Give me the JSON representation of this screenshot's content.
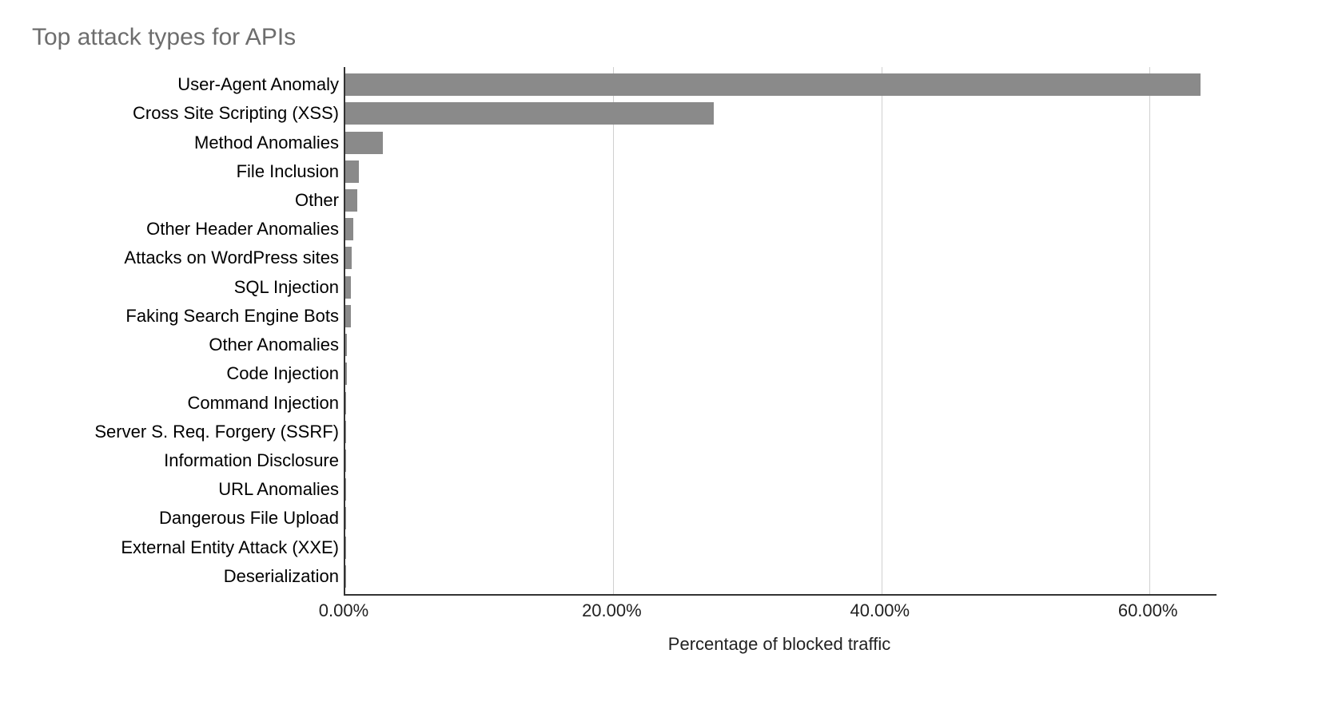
{
  "chart_data": {
    "type": "bar",
    "orientation": "horizontal",
    "title": "Top attack types for APIs",
    "xlabel": "Percentage of blocked traffic",
    "ylabel": "",
    "categories": [
      "User-Agent Anomaly",
      "Cross Site Scripting (XSS)",
      "Method Anomalies",
      "File Inclusion",
      "Other",
      "Other Header Anomalies",
      "Attacks on WordPress sites",
      "SQL Injection",
      "Faking Search Engine Bots",
      "Other Anomalies",
      "Code Injection",
      "Command Injection",
      "Server S. Req. Forgery (SSRF)",
      "Information Disclosure",
      "URL Anomalies",
      "Dangerous File Upload",
      "External Entity Attack (XXE)",
      "Deserialization"
    ],
    "values": [
      63.8,
      27.5,
      2.8,
      1.0,
      0.9,
      0.6,
      0.5,
      0.4,
      0.4,
      0.1,
      0.1,
      0.05,
      0.05,
      0.05,
      0.05,
      0.02,
      0.02,
      0.02
    ],
    "xlim": [
      0,
      65
    ],
    "xticks": [
      0,
      20,
      40,
      60
    ],
    "xtick_labels": [
      "0.00%",
      "20.00%",
      "40.00%",
      "60.00%"
    ],
    "bar_color": "#8a8a8a"
  }
}
